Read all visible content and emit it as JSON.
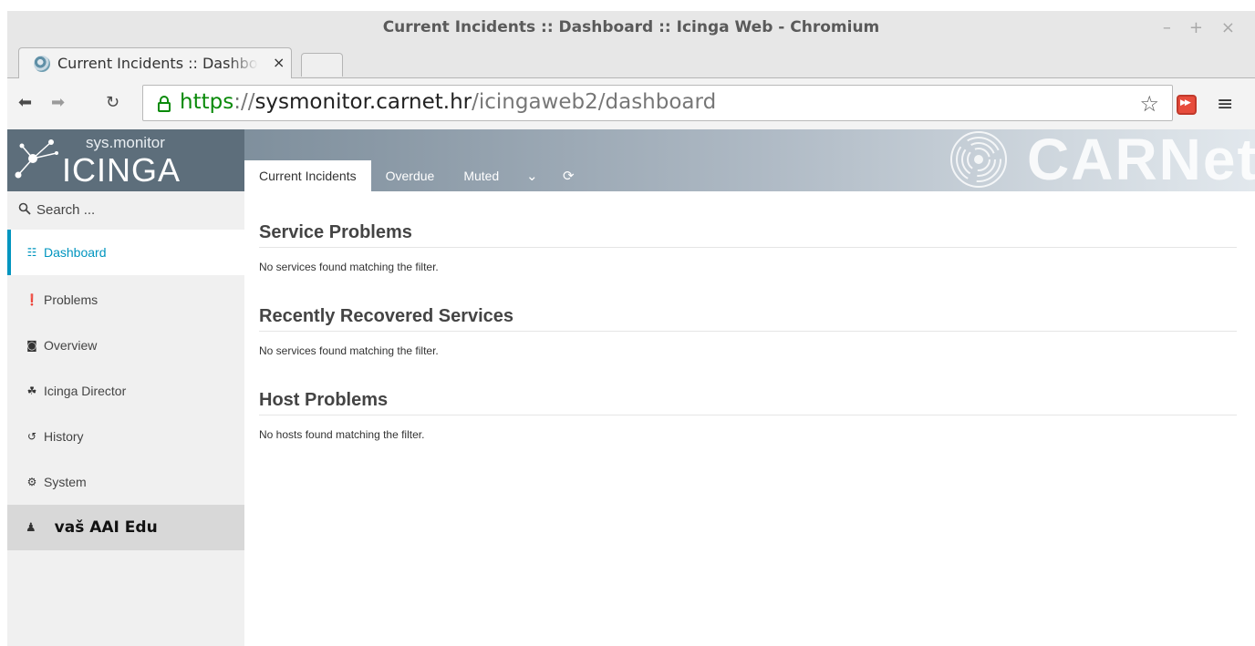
{
  "window": {
    "title": "Current Incidents :: Dashboard :: Icinga Web - Chromium",
    "controls": {
      "minimize": "–",
      "maximize": "+",
      "close": "×"
    }
  },
  "browser": {
    "tab_title": "Current Incidents :: Dashboard :: Icinga Web",
    "tab_close": "×",
    "url": {
      "scheme": "https",
      "separator": "://",
      "host": "sysmonitor.carnet.hr",
      "path": "/icingaweb2/dashboard"
    },
    "icons": {
      "back": "back-arrow-icon",
      "forward": "forward-arrow-icon",
      "reload": "reload-icon",
      "lock": "lock-icon",
      "bookmark": "star-icon",
      "extension": "extension-icon",
      "menu": "hamburger-menu-icon"
    }
  },
  "header": {
    "logo_sub": "sys.monitor",
    "logo_main": "ICINGA",
    "brand": "CARNet",
    "tabs": [
      {
        "label": "Current Incidents",
        "active": true
      },
      {
        "label": "Overdue",
        "active": false
      },
      {
        "label": "Muted",
        "active": false
      }
    ]
  },
  "sidebar": {
    "search_placeholder": "Search ...",
    "items": [
      {
        "label": "Dashboard",
        "icon": "grid-icon",
        "active": true
      },
      {
        "label": "Problems",
        "icon": "alert-icon",
        "active": false
      },
      {
        "label": "Overview",
        "icon": "binoculars-icon",
        "active": false
      },
      {
        "label": "Icinga Director",
        "icon": "director-icon",
        "active": false
      },
      {
        "label": "History",
        "icon": "history-icon",
        "active": false
      },
      {
        "label": "System",
        "icon": "cogs-icon",
        "active": false
      }
    ],
    "user": "vaš AAI Edu"
  },
  "main": {
    "sections": [
      {
        "title": "Service Problems",
        "message": "No services found matching the filter."
      },
      {
        "title": "Recently Recovered Services",
        "message": "No services found matching the filter."
      },
      {
        "title": "Host Problems",
        "message": "No hosts found matching the filter."
      }
    ]
  },
  "colors": {
    "accent": "#0095bf",
    "header_dark": "#5d6e7b",
    "sidebar_bg": "#f0f0f0",
    "secure_green": "#0a8a0a"
  }
}
